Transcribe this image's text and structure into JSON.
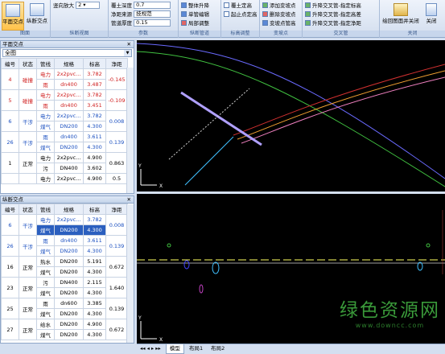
{
  "ribbon": {
    "group_view": {
      "title": "图面",
      "btn_plan": "平面交点",
      "btn_profile": "纵断交点"
    },
    "group_profile_view": {
      "title": "纵断视图",
      "scale_label": "竖向放大",
      "scale_value": "2"
    },
    "group_params": {
      "title": "参数",
      "cover_label": "覆土深度",
      "cover_value": "0.7",
      "clear_label": "净距来源",
      "clear_value": "技规范",
      "wall_label": "管道厚度",
      "wall_value": "0.15"
    },
    "group_pipe": {
      "title": "纵断管道",
      "items": [
        "整体升降",
        "单管编辑",
        "局部调整"
      ]
    },
    "group_label": {
      "title": "标高调整",
      "items": [
        "覆土定高",
        "起止点定高"
      ]
    },
    "group_vertex": {
      "title": "变坡点",
      "items": [
        "添加变坡点",
        "删除变坡点",
        "变坡点管高"
      ]
    },
    "group_cross": {
      "title": "交叉管",
      "items": [
        "升降交叉管-指定标高",
        "升降交叉管-指定高差",
        "升降交叉管-指定净距"
      ]
    },
    "group_close": {
      "title": "关闭",
      "export_label": "绘回图面并关闭",
      "close_label": "关闭"
    }
  },
  "plan_panel": {
    "title": "平面交点",
    "close": "✕",
    "filter_value": "全图",
    "headers": [
      "编号",
      "状态",
      "管线",
      "规格",
      "标高",
      "净距"
    ],
    "rows": [
      {
        "id": "4",
        "status": "碰撞",
        "color": "red",
        "lines": [
          [
            "电力",
            "2x2pvc...",
            "3.782"
          ],
          [
            "雨",
            "dn400",
            "3.487"
          ]
        ],
        "clear": "-0.145"
      },
      {
        "id": "5",
        "status": "碰撞",
        "color": "red",
        "lines": [
          [
            "电力",
            "2x2pvc...",
            "3.782"
          ],
          [
            "雨",
            "dn400",
            "3.451"
          ]
        ],
        "clear": "-0.109"
      },
      {
        "id": "6",
        "status": "干涉",
        "color": "blue",
        "lines": [
          [
            "电力",
            "2x2pvc...",
            "3.782"
          ],
          [
            "煤气",
            "DN200",
            "4.300"
          ]
        ],
        "clear": "0.008"
      },
      {
        "id": "26",
        "status": "干涉",
        "color": "blue",
        "lines": [
          [
            "雨",
            "dn400",
            "3.611"
          ],
          [
            "煤气",
            "DN200",
            "4.300"
          ]
        ],
        "clear": "0.139"
      },
      {
        "id": "1",
        "status": "正常",
        "color": "black",
        "lines": [
          [
            "电力",
            "2x2pvc...",
            "4.900"
          ],
          [
            "污",
            "DN400",
            "3.602"
          ]
        ],
        "clear": "0.863"
      },
      {
        "id": "",
        "status": "",
        "color": "black",
        "lines": [
          [
            "电力",
            "2x2pvc...",
            "4.900"
          ]
        ],
        "clear": "0.5"
      }
    ]
  },
  "profile_panel": {
    "title": "纵断交点",
    "close": "✕",
    "headers": [
      "编号",
      "状态",
      "管线",
      "规格",
      "标高",
      "净距"
    ],
    "rows": [
      {
        "id": "6",
        "status": "干涉",
        "color": "blue",
        "lines": [
          [
            "电力",
            "2x2pvc...",
            "3.782"
          ],
          [
            "煤气",
            "DN200",
            "4.300"
          ]
        ],
        "clear": "0.008",
        "selected": true
      },
      {
        "id": "26",
        "status": "干涉",
        "color": "blue",
        "lines": [
          [
            "雨",
            "dn400",
            "3.611"
          ],
          [
            "煤气",
            "DN200",
            "4.300"
          ]
        ],
        "clear": "0.139"
      },
      {
        "id": "16",
        "status": "正常",
        "color": "black",
        "lines": [
          [
            "热水",
            "DN200",
            "5.191"
          ],
          [
            "煤气",
            "DN200",
            "4.300"
          ]
        ],
        "clear": "0.672"
      },
      {
        "id": "23",
        "status": "正常",
        "color": "black",
        "lines": [
          [
            "污",
            "DN400",
            "2.115"
          ],
          [
            "煤气",
            "DN200",
            "4.300"
          ]
        ],
        "clear": "1.640"
      },
      {
        "id": "25",
        "status": "正常",
        "color": "black",
        "lines": [
          [
            "雨",
            "dn600",
            "3.385"
          ],
          [
            "煤气",
            "DN200",
            "4.300"
          ]
        ],
        "clear": "0.139"
      },
      {
        "id": "27",
        "status": "正常",
        "color": "black",
        "lines": [
          [
            "给水",
            "DN200",
            "4.900"
          ],
          [
            "煤气",
            "DN200",
            "4.300"
          ]
        ],
        "clear": "0.672"
      }
    ]
  },
  "canvas": {
    "axis_y": "Y",
    "axis_x": "X"
  },
  "tabs": {
    "nav": "◂◂ ◂ ▸ ▸▸",
    "items": [
      "模型",
      "布局1",
      "布局2"
    ]
  },
  "watermark": {
    "main": "绿色资源网",
    "url": "www.downcc.com"
  },
  "colors": {
    "ribbon_bg": "#d2ddee",
    "canvas_bg": "#000000",
    "collision": "#d02020",
    "interference": "#1a4fc0",
    "watermark": "#3a9a3a"
  }
}
